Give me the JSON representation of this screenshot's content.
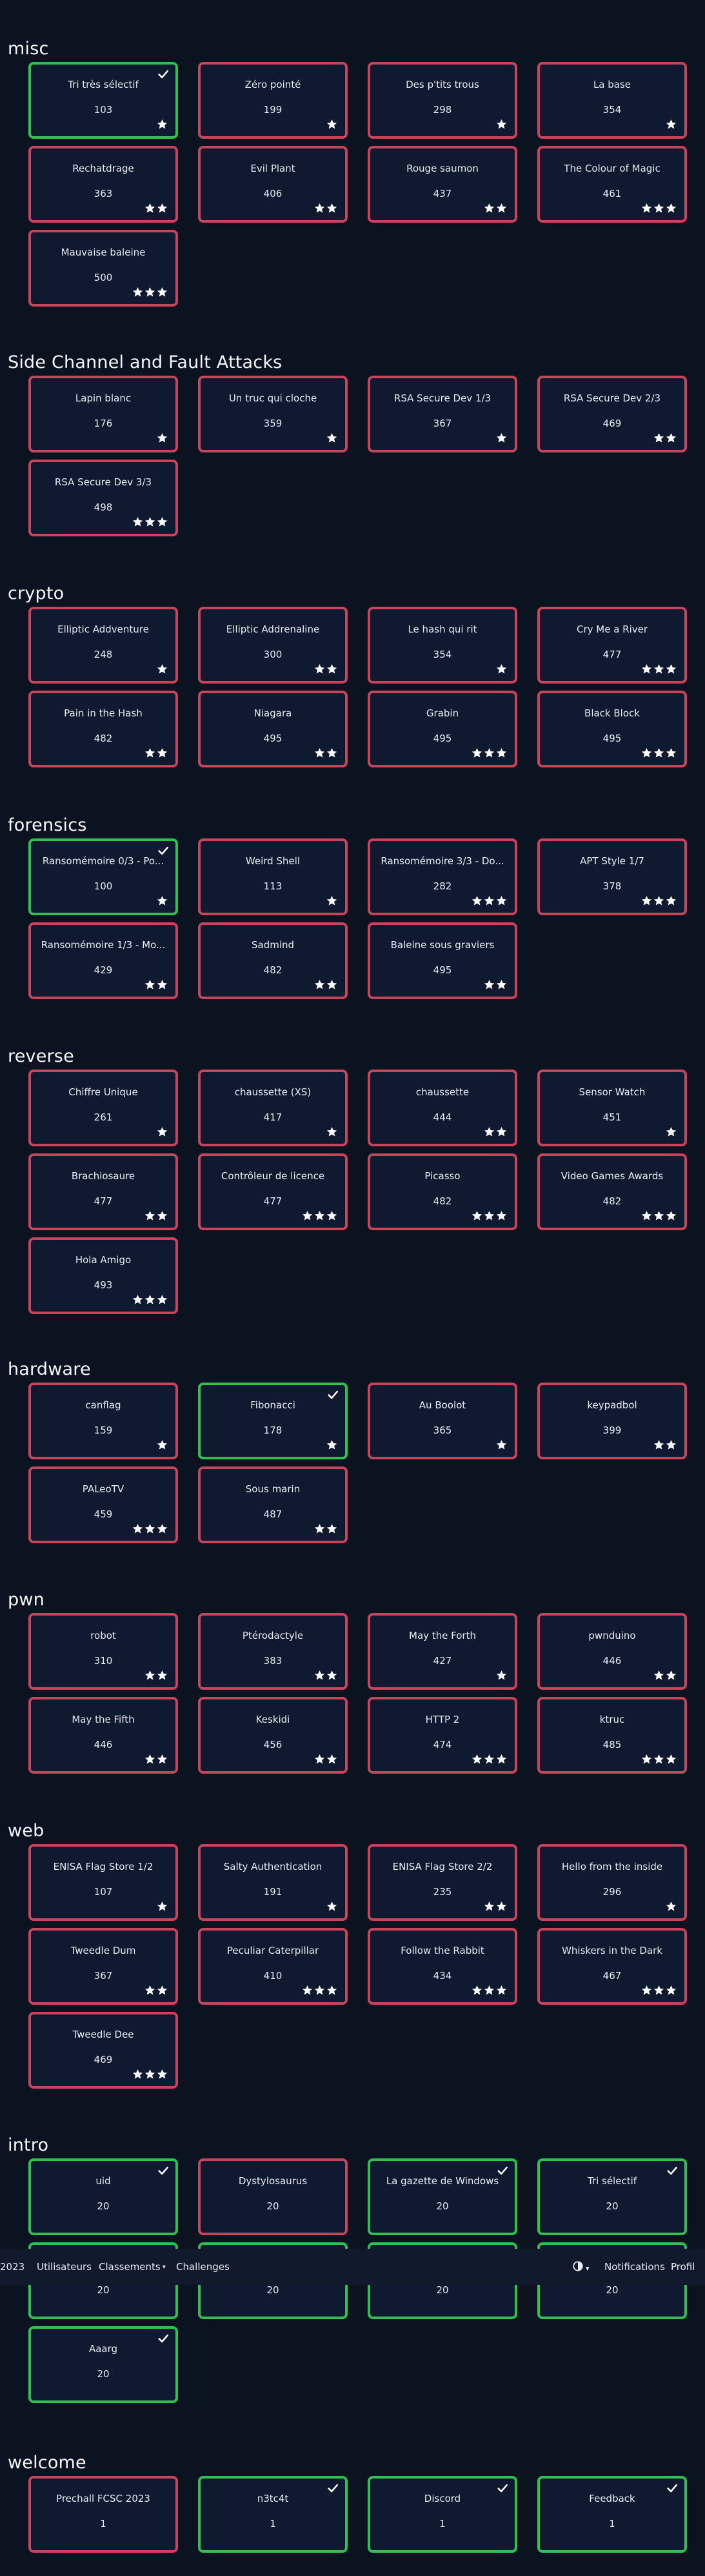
{
  "navbar": {
    "brand": "2023",
    "links": [
      "Utilisateurs",
      "Classements",
      "Challenges"
    ],
    "theme_caret": "▾",
    "right_links": [
      "Notifications",
      "Profil"
    ]
  },
  "categories": [
    {
      "name": "misc",
      "challenges": [
        {
          "name": "Tri très sélectif",
          "points": "103",
          "stars": 1,
          "solved": true
        },
        {
          "name": "Zéro pointé",
          "points": "199",
          "stars": 1,
          "solved": false
        },
        {
          "name": "Des p'tits trous",
          "points": "298",
          "stars": 1,
          "solved": false
        },
        {
          "name": "La base",
          "points": "354",
          "stars": 1,
          "solved": false
        },
        {
          "name": "Rechatdrage",
          "points": "363",
          "stars": 2,
          "solved": false
        },
        {
          "name": "Evil Plant",
          "points": "406",
          "stars": 2,
          "solved": false
        },
        {
          "name": "Rouge saumon",
          "points": "437",
          "stars": 2,
          "solved": false
        },
        {
          "name": "The Colour of Magic",
          "points": "461",
          "stars": 3,
          "solved": false
        },
        {
          "name": "Mauvaise baleine",
          "points": "500",
          "stars": 3,
          "solved": false
        }
      ]
    },
    {
      "name": "Side Channel and Fault Attacks",
      "challenges": [
        {
          "name": "Lapin blanc",
          "points": "176",
          "stars": 1,
          "solved": false
        },
        {
          "name": "Un truc qui cloche",
          "points": "359",
          "stars": 1,
          "solved": false
        },
        {
          "name": "RSA Secure Dev 1/3",
          "points": "367",
          "stars": 1,
          "solved": false
        },
        {
          "name": "RSA Secure Dev 2/3",
          "points": "469",
          "stars": 2,
          "solved": false
        },
        {
          "name": "RSA Secure Dev 3/3",
          "points": "498",
          "stars": 3,
          "solved": false
        }
      ]
    },
    {
      "name": "crypto",
      "challenges": [
        {
          "name": "Elliptic Addventure",
          "points": "248",
          "stars": 1,
          "solved": false
        },
        {
          "name": "Elliptic Addrenaline",
          "points": "300",
          "stars": 2,
          "solved": false
        },
        {
          "name": "Le hash qui rit",
          "points": "354",
          "stars": 1,
          "solved": false
        },
        {
          "name": "Cry Me a River",
          "points": "477",
          "stars": 3,
          "solved": false
        },
        {
          "name": "Pain in the Hash",
          "points": "482",
          "stars": 2,
          "solved": false
        },
        {
          "name": "Niagara",
          "points": "495",
          "stars": 2,
          "solved": false
        },
        {
          "name": "Grabin",
          "points": "495",
          "stars": 3,
          "solved": false
        },
        {
          "name": "Black Block",
          "points": "495",
          "stars": 3,
          "solved": false
        }
      ]
    },
    {
      "name": "forensics",
      "challenges": [
        {
          "name": "Ransomémoire 0/3 - Po...",
          "points": "100",
          "stars": 1,
          "solved": true
        },
        {
          "name": "Weird Shell",
          "points": "113",
          "stars": 1,
          "solved": false
        },
        {
          "name": "Ransomémoire 3/3 - Do...",
          "points": "282",
          "stars": 3,
          "solved": false
        },
        {
          "name": "APT Style 1/7",
          "points": "378",
          "stars": 3,
          "solved": false
        },
        {
          "name": "Ransomémoire 1/3 - Mo...",
          "points": "429",
          "stars": 2,
          "solved": false
        },
        {
          "name": "Sadmind",
          "points": "482",
          "stars": 2,
          "solved": false
        },
        {
          "name": "Baleine sous graviers",
          "points": "495",
          "stars": 2,
          "solved": false
        }
      ]
    },
    {
      "name": "reverse",
      "challenges": [
        {
          "name": "Chiffre Unique",
          "points": "261",
          "stars": 1,
          "solved": false
        },
        {
          "name": "chaussette (XS)",
          "points": "417",
          "stars": 1,
          "solved": false
        },
        {
          "name": "chaussette",
          "points": "444",
          "stars": 2,
          "solved": false
        },
        {
          "name": "Sensor Watch",
          "points": "451",
          "stars": 1,
          "solved": false
        },
        {
          "name": "Brachiosaure",
          "points": "477",
          "stars": 2,
          "solved": false
        },
        {
          "name": "Contrôleur de licence",
          "points": "477",
          "stars": 3,
          "solved": false
        },
        {
          "name": "Picasso",
          "points": "482",
          "stars": 3,
          "solved": false
        },
        {
          "name": "Video Games Awards",
          "points": "482",
          "stars": 3,
          "solved": false
        },
        {
          "name": "Hola Amigo",
          "points": "493",
          "stars": 3,
          "solved": false
        }
      ]
    },
    {
      "name": "hardware",
      "challenges": [
        {
          "name": "canflag",
          "points": "159",
          "stars": 1,
          "solved": false
        },
        {
          "name": "Fibonacci",
          "points": "178",
          "stars": 1,
          "solved": true
        },
        {
          "name": "Au Boolot",
          "points": "365",
          "stars": 1,
          "solved": false
        },
        {
          "name": "keypadbol",
          "points": "399",
          "stars": 2,
          "solved": false
        },
        {
          "name": "PALeoTV",
          "points": "459",
          "stars": 3,
          "solved": false
        },
        {
          "name": "Sous marin",
          "points": "487",
          "stars": 2,
          "solved": false
        }
      ]
    },
    {
      "name": "pwn",
      "challenges": [
        {
          "name": "robot",
          "points": "310",
          "stars": 2,
          "solved": false
        },
        {
          "name": "Ptérodactyle",
          "points": "383",
          "stars": 2,
          "solved": false
        },
        {
          "name": "May the Forth",
          "points": "427",
          "stars": 1,
          "solved": false
        },
        {
          "name": "pwnduino",
          "points": "446",
          "stars": 2,
          "solved": false
        },
        {
          "name": "May the Fifth",
          "points": "446",
          "stars": 2,
          "solved": false
        },
        {
          "name": "Keskidi",
          "points": "456",
          "stars": 2,
          "solved": false
        },
        {
          "name": "HTTP 2",
          "points": "474",
          "stars": 3,
          "solved": false
        },
        {
          "name": "ktruc",
          "points": "485",
          "stars": 3,
          "solved": false
        }
      ]
    },
    {
      "name": "web",
      "challenges": [
        {
          "name": "ENISA Flag Store 1/2",
          "points": "107",
          "stars": 1,
          "solved": false
        },
        {
          "name": "Salty Authentication",
          "points": "191",
          "stars": 1,
          "solved": false
        },
        {
          "name": "ENISA Flag Store 2/2",
          "points": "235",
          "stars": 2,
          "solved": false
        },
        {
          "name": "Hello from the inside",
          "points": "296",
          "stars": 1,
          "solved": false
        },
        {
          "name": "Tweedle Dum",
          "points": "367",
          "stars": 2,
          "solved": false
        },
        {
          "name": "Peculiar Caterpillar",
          "points": "410",
          "stars": 3,
          "solved": false
        },
        {
          "name": "Follow the Rabbit",
          "points": "434",
          "stars": 3,
          "solved": false
        },
        {
          "name": "Whiskers in the Dark",
          "points": "467",
          "stars": 3,
          "solved": false
        },
        {
          "name": "Tweedle Dee",
          "points": "469",
          "stars": 3,
          "solved": false
        }
      ]
    },
    {
      "name": "intro",
      "challenges": [
        {
          "name": "uid",
          "points": "20",
          "stars": 0,
          "solved": true
        },
        {
          "name": "Dystylosaurus",
          "points": "20",
          "stars": 0,
          "solved": false
        },
        {
          "name": "La gazette de Windows",
          "points": "20",
          "stars": 0,
          "solved": true
        },
        {
          "name": "Tri sélectif",
          "points": "20",
          "stars": 0,
          "solved": true
        },
        {
          "name": "",
          "points": "20",
          "stars": 0,
          "solved": true
        },
        {
          "name": "",
          "points": "20",
          "stars": 0,
          "solved": true
        },
        {
          "name": "",
          "points": "20",
          "stars": 0,
          "solved": true
        },
        {
          "name": "",
          "points": "20",
          "stars": 0,
          "solved": true
        },
        {
          "name": "Aaarg",
          "points": "20",
          "stars": 0,
          "solved": true
        }
      ]
    },
    {
      "name": "welcome",
      "challenges": [
        {
          "name": "Prechall FCSC 2023",
          "points": "1",
          "stars": 0,
          "solved": false
        },
        {
          "name": "n3tc4t",
          "points": "1",
          "stars": 0,
          "solved": true
        },
        {
          "name": "Discord",
          "points": "1",
          "stars": 0,
          "solved": true
        },
        {
          "name": "Feedback",
          "points": "1",
          "stars": 0,
          "solved": true
        }
      ]
    }
  ]
}
